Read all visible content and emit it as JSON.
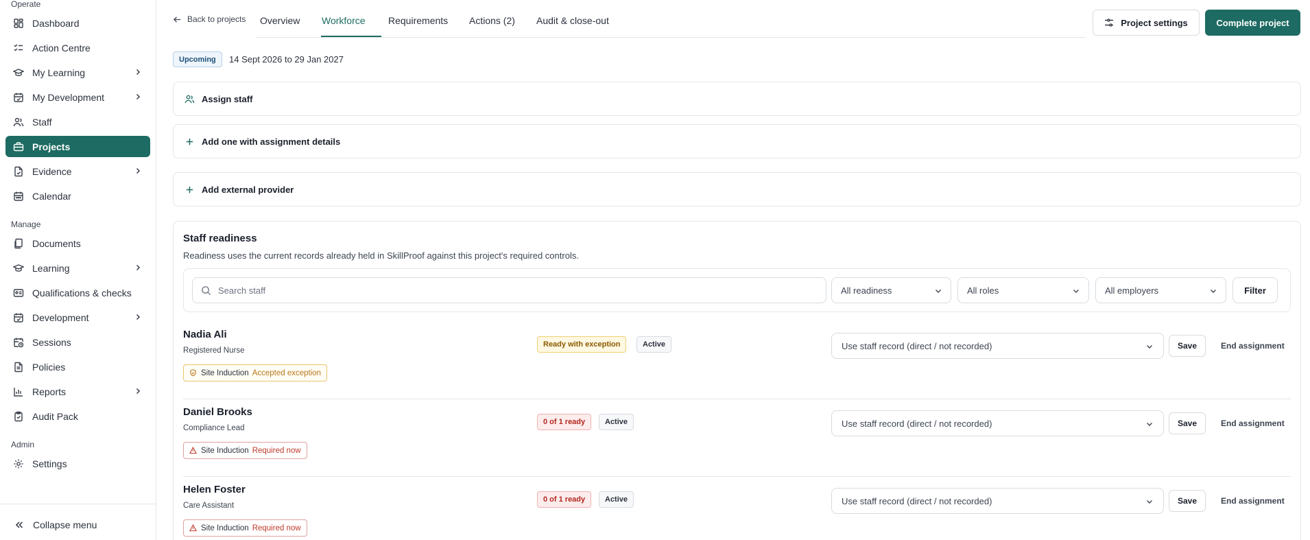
{
  "sidebar": {
    "sections": {
      "operate": "Operate",
      "manage": "Manage",
      "admin": "Admin"
    },
    "items": [
      {
        "label": "Dashboard",
        "icon": "dashboard-icon"
      },
      {
        "label": "Action Centre",
        "icon": "list-checks-icon"
      },
      {
        "label": "My Learning",
        "icon": "graduation-cap-icon"
      },
      {
        "label": "My Development",
        "icon": "calendar-check-icon"
      },
      {
        "label": "Staff",
        "icon": "users-icon"
      },
      {
        "label": "Projects",
        "icon": "briefcase-icon"
      },
      {
        "label": "Evidence",
        "icon": "file-check-icon"
      },
      {
        "label": "Calendar",
        "icon": "calendar-icon"
      },
      {
        "label": "Documents",
        "icon": "documents-icon"
      },
      {
        "label": "Learning",
        "icon": "graduation-cap-icon"
      },
      {
        "label": "Qualifications & checks",
        "icon": "id-card-icon"
      },
      {
        "label": "Development",
        "icon": "calendar-check-icon"
      },
      {
        "label": "Sessions",
        "icon": "calendar-clock-icon"
      },
      {
        "label": "Policies",
        "icon": "file-text-icon"
      },
      {
        "label": "Reports",
        "icon": "bar-chart-icon"
      },
      {
        "label": "Audit Pack",
        "icon": "clipboard-icon"
      },
      {
        "label": "Settings",
        "icon": "gear-icon"
      }
    ],
    "collapse_label": "Collapse menu"
  },
  "header": {
    "back_label": "Back to projects",
    "tabs": [
      "Overview",
      "Workforce",
      "Requirements",
      "Actions (2)",
      "Audit & close-out"
    ],
    "active_tab": "Workforce",
    "settings_label": "Project settings",
    "complete_label": "Complete project"
  },
  "project": {
    "status": "Upcoming",
    "date_range": "14 Sept 2026 to 29 Jan 2027"
  },
  "actions": {
    "assign_staff": "Assign staff",
    "add_one": "Add one with assignment details",
    "add_external": "Add external provider"
  },
  "readiness": {
    "title": "Staff readiness",
    "subtitle": "Readiness uses the current records already held in SkillProof against this project's required controls.",
    "search_placeholder": "Search staff",
    "filters": [
      "All readiness",
      "All roles",
      "All employers"
    ],
    "filter_button": "Filter",
    "staff": [
      {
        "name": "Nadia Ali",
        "role": "Registered Nurse",
        "readiness": "Ready with exception",
        "state": "Active",
        "requirement": "Site Induction",
        "requirement_status": "Accepted exception",
        "record_select": "Use staff record (direct / not recorded)",
        "save": "Save",
        "end": "End assignment"
      },
      {
        "name": "Daniel Brooks",
        "role": "Compliance Lead",
        "readiness": "0 of 1 ready",
        "state": "Active",
        "requirement": "Site Induction",
        "requirement_status": "Required now",
        "record_select": "Use staff record (direct / not recorded)",
        "save": "Save",
        "end": "End assignment"
      },
      {
        "name": "Helen Foster",
        "role": "Care Assistant",
        "readiness": "0 of 1 ready",
        "state": "Active",
        "requirement": "Site Induction",
        "requirement_status": "Required now",
        "record_select": "Use staff record (direct / not recorded)",
        "save": "Save",
        "end": "End assignment"
      }
    ]
  },
  "colors": {
    "brand": "#1d6b62",
    "amber": "#b9781a",
    "red": "#c0392b"
  }
}
